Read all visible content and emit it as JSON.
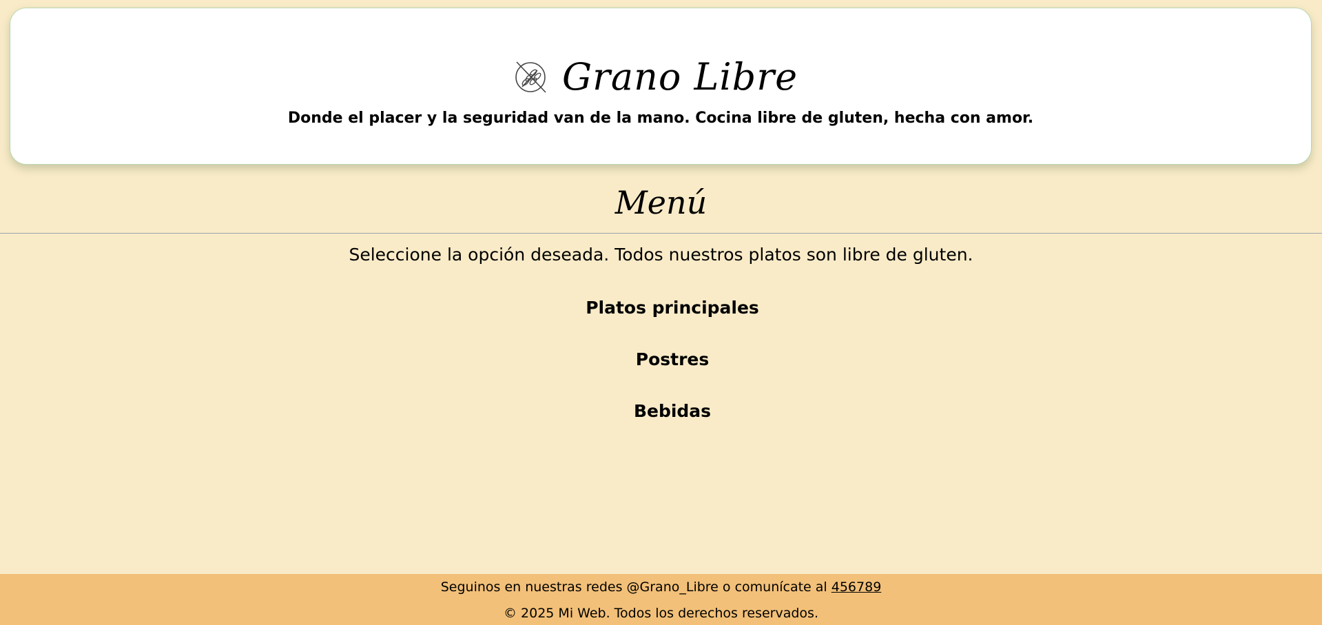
{
  "header": {
    "logo_icon": "gluten-free-wheat-icon",
    "title": "Grano Libre",
    "tagline": "Donde el placer y la seguridad van de la mano. Cocina libre de gluten, hecha con amor."
  },
  "menu": {
    "heading": "Menú",
    "intro": "Seleccione la opción deseada. Todos nuestros platos son libre de gluten.",
    "options": [
      {
        "label": "Platos principales"
      },
      {
        "label": "Postres"
      },
      {
        "label": "Bebidas"
      }
    ]
  },
  "footer": {
    "social_text": "Seguinos en nuestras redes @Grano_Libre o comunícate al ",
    "phone": "456789",
    "copyright": "© 2025 Mi Web. Todos los derechos reservados."
  },
  "colors": {
    "page_background": "#f9ebc8",
    "header_card": "#ffffff",
    "footer_background": "#f2c079",
    "divider": "#9aa3ad"
  }
}
